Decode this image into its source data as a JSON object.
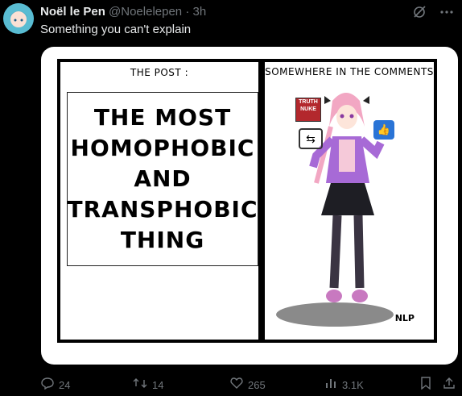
{
  "tweet": {
    "author_name": "Noël le Pen",
    "handle": "@Noelelepen",
    "separator": "·",
    "time": "3h",
    "text": "Something you can't explain"
  },
  "meme": {
    "left_label": "THE POST :",
    "post_text": "THE MOST HOMOPHOBIC AND TRANSPHOBIC THING",
    "right_label": "SOMEWHERE IN THE COMMENTS",
    "badge_text": "TRUTH NUKE",
    "signature": "NLP"
  },
  "actions": {
    "replies": "24",
    "reposts": "14",
    "likes": "265",
    "views": "3.1K"
  },
  "icons": {
    "grok": "grok-icon",
    "more": "more-icon",
    "reply": "reply-icon",
    "repost": "repost-icon",
    "like": "heart-icon",
    "views": "views-icon",
    "bookmark": "bookmark-icon",
    "share": "share-icon"
  }
}
